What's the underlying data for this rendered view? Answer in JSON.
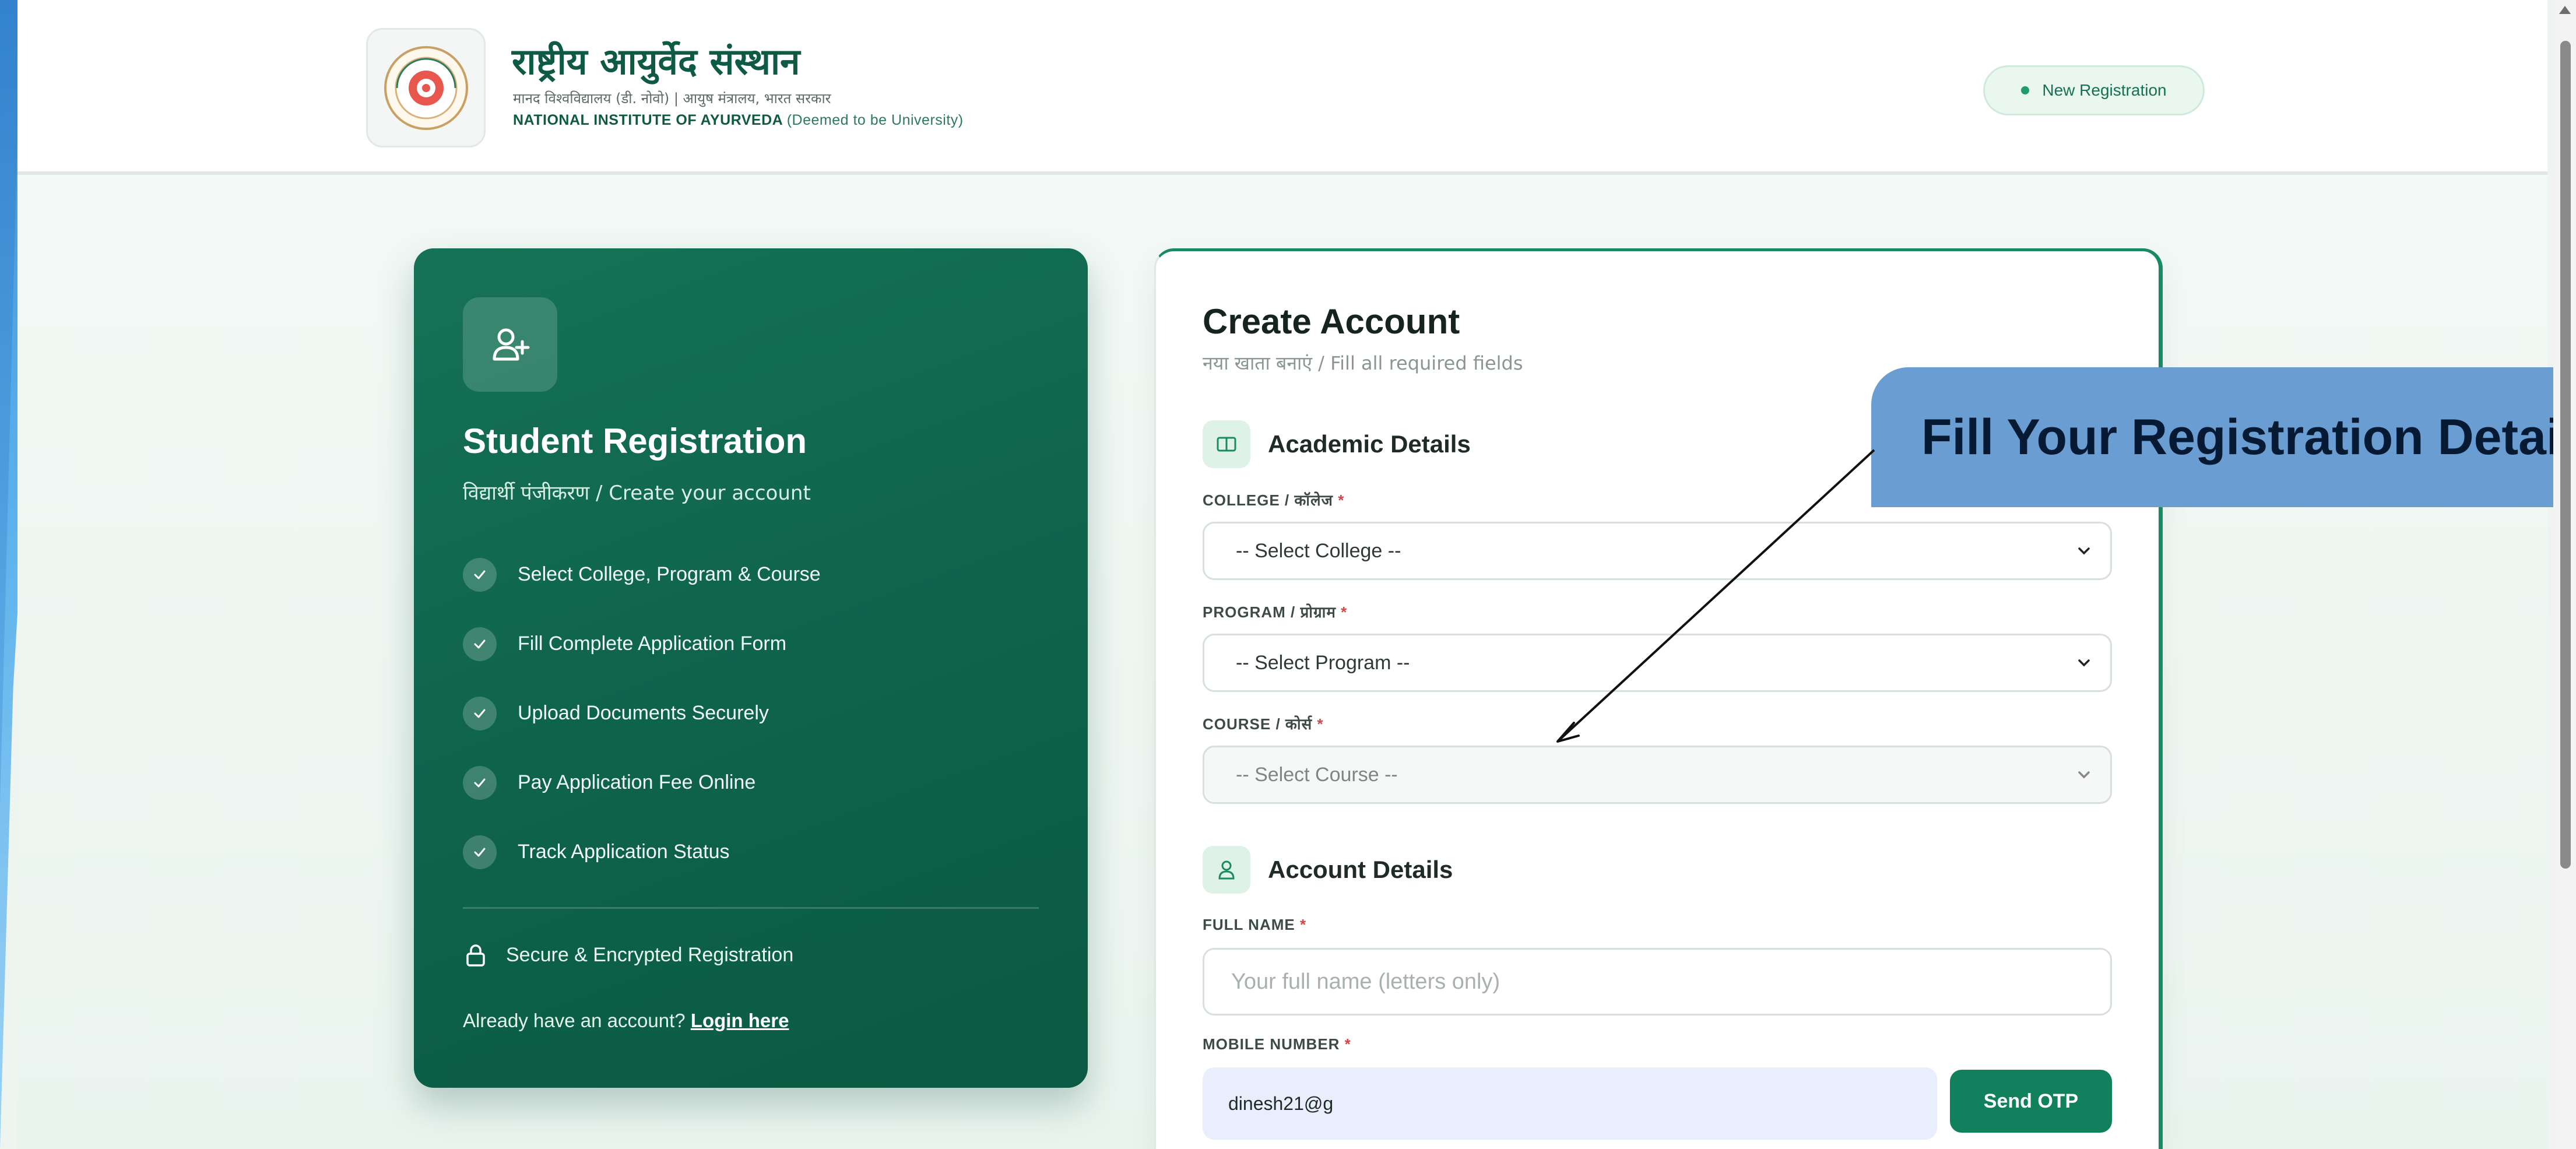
{
  "header": {
    "institute_hindi": "राष्ट्रीय आयुर्वेद संस्थान",
    "institute_sub": "मानद विश्वविद्यालय (डी. नोवो) | आयुष मंत्रालय, भारत सरकार",
    "institute_english": "NATIONAL INSTITUTE OF AYURVEDA",
    "institute_english_tail": "(Deemed to be University)",
    "badge": "New Registration"
  },
  "left_panel": {
    "title": "Student Registration",
    "subtitle": "विद्यार्थी पंजीकरण / Create your account",
    "features": [
      "Select College, Program & Course",
      "Fill Complete Application Form",
      "Upload Documents Securely",
      "Pay Application Fee Online",
      "Track Application Status"
    ],
    "secure_text": "Secure & Encrypted Registration",
    "already_text": "Already have an account?",
    "login_link": "Login here"
  },
  "form": {
    "title": "Create Account",
    "subtitle": "नया खाता बनाएं / Fill all required fields",
    "academic_heading": "Academic Details",
    "college_label": "COLLEGE / कॉलेज",
    "college_value": "-- Select College --",
    "program_label": "PROGRAM / प्रोग्राम",
    "program_value": "-- Select Program --",
    "course_label": "COURSE / कोर्स",
    "course_value": "-- Select Course --",
    "account_heading": "Account Details",
    "fullname_label": "FULL NAME",
    "fullname_placeholder": "Your full name (letters only)",
    "mobile_label": "MOBILE NUMBER",
    "mobile_value": "dinesh21@g",
    "send_otp": "Send OTP",
    "required_mark": "*"
  },
  "callout": {
    "text": "Fill Your Registration Details"
  },
  "colors": {
    "primary_green": "#0e644b",
    "button_green": "#11805d",
    "callout_blue": "#6a9ed2"
  }
}
